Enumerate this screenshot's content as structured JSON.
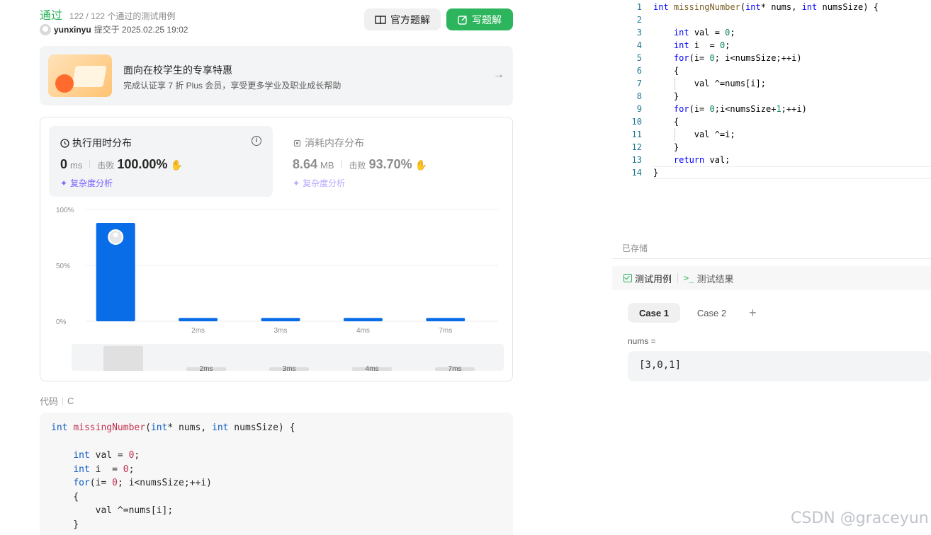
{
  "submission": {
    "status": "通过",
    "passed_count": "122 / 122 个通过的测试用例",
    "author": "yunxinyu",
    "submitted_at": "提交于 2025.02.25 19:02"
  },
  "buttons": {
    "official_solution": "官方题解",
    "write_solution": "写题解"
  },
  "promo": {
    "title": "面向在校学生的专享特惠",
    "subtitle": "完成认证享 7 折 Plus 会员，享受更多学业及职业成长帮助"
  },
  "runtime": {
    "title": "执行用时分布",
    "value": "0",
    "unit": "ms",
    "beat_label": "击败",
    "beat_value": "100.00%",
    "complexity_link": "复杂度分析"
  },
  "memory": {
    "title": "消耗内存分布",
    "value": "8.64",
    "unit": "MB",
    "beat_label": "击败",
    "beat_value": "93.70%",
    "complexity_link": "复杂度分析"
  },
  "chart_data": {
    "type": "bar",
    "categories": [
      "0ms",
      "2ms",
      "3ms",
      "4ms",
      "7ms"
    ],
    "x_tick_labels": [
      "",
      "2ms",
      "3ms",
      "4ms",
      "7ms"
    ],
    "values": [
      88,
      3,
      3,
      3,
      3
    ],
    "ylim": [
      0,
      100
    ],
    "y_ticks": [
      "0%",
      "50%",
      "100%"
    ],
    "grid": true,
    "bar_color": "#0a6de8",
    "highlight_index": 0
  },
  "code_section": {
    "label": "代码",
    "language": "C"
  },
  "code_lines": [
    "int missingNumber(int* nums, int numsSize) {",
    "",
    "    int val = 0;",
    "    int i  = 0;",
    "    for(i= 0; i<numsSize;++i)",
    "    {",
    "        val ^=nums[i];",
    "    }"
  ],
  "editor": {
    "lines": [
      "int missingNumber(int* nums, int numsSize) {",
      "",
      "    int val = 0;",
      "    int i  = 0;",
      "    for(i= 0; i<numsSize;++i)",
      "    {",
      "        val ^=nums[i];",
      "    }",
      "    for(i= 0;i<numsSize+1;++i)",
      "    {",
      "        val ^=i;",
      "    }",
      "    return val;",
      "}"
    ],
    "saved_status": "已存储"
  },
  "test_panel": {
    "tab_cases": "测试用例",
    "tab_results": "测试结果",
    "case_tabs": [
      "Case 1",
      "Case 2"
    ],
    "input_label": "nums =",
    "input_value": "[3,0,1]"
  },
  "watermark": "CSDN @graceyun",
  "colors": {
    "accept_green": "#2db55d",
    "bar_blue": "#0a6de8",
    "complexity_purple": "#7b61ff"
  }
}
